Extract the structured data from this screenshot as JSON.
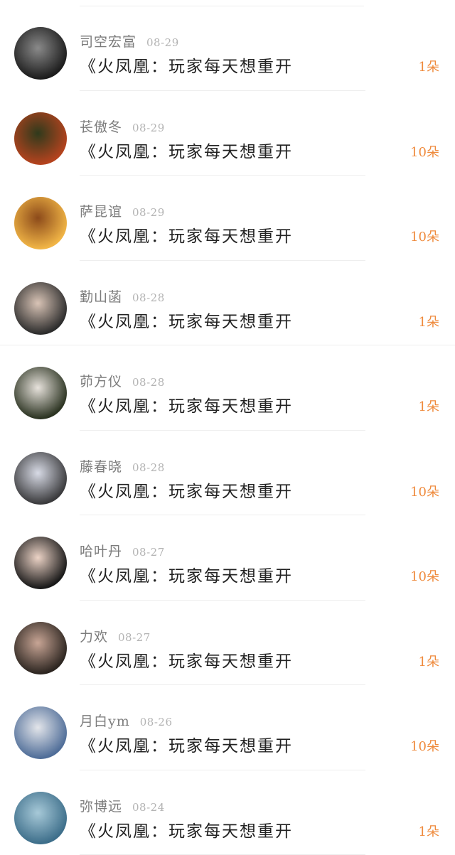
{
  "rows": [
    {
      "name": "司空宏富",
      "date": "08-29",
      "title": "《火凤凰：玩家每天想重开",
      "gift": "1朵",
      "avatar_icon": "avatar-user-1",
      "avatar_colors": [
        "#1c1c1c",
        "#8a8a8a"
      ]
    },
    {
      "name": "苌傲冬",
      "date": "08-29",
      "title": "《火凤凰：玩家每天想重开",
      "gift": "10朵",
      "avatar_icon": "avatar-user-2",
      "avatar_colors": [
        "#b5431e",
        "#2f3a1c"
      ]
    },
    {
      "name": "萨昆谊",
      "date": "08-29",
      "title": "《火凤凰：玩家每天想重开",
      "gift": "10朵",
      "avatar_icon": "avatar-user-3",
      "avatar_colors": [
        "#f1b546",
        "#8c4a1a"
      ]
    },
    {
      "name": "勤山菡",
      "date": "08-28",
      "title": "《火凤凰：玩家每天想重开",
      "gift": "1朵",
      "avatar_icon": "avatar-user-4",
      "avatar_colors": [
        "#2c2c2c",
        "#d9c4b6"
      ]
    },
    {
      "name": "茆方仪",
      "date": "08-28",
      "title": "《火凤凰：玩家每天想重开",
      "gift": "1朵",
      "avatar_icon": "avatar-user-5",
      "avatar_colors": [
        "#2b3321",
        "#e7e2dc"
      ]
    },
    {
      "name": "藤春晓",
      "date": "08-28",
      "title": "《火凤凰：玩家每天想重开",
      "gift": "10朵",
      "avatar_icon": "avatar-user-6",
      "avatar_colors": [
        "#3a3a3c",
        "#d8dbe6"
      ]
    },
    {
      "name": "哈叶丹",
      "date": "08-27",
      "title": "《火凤凰：玩家每天想重开",
      "gift": "10朵",
      "avatar_icon": "avatar-user-7",
      "avatar_colors": [
        "#181818",
        "#ecd3c6"
      ]
    },
    {
      "name": "力欢",
      "date": "08-27",
      "title": "《火凤凰：玩家每天想重开",
      "gift": "1朵",
      "avatar_icon": "avatar-user-8",
      "avatar_colors": [
        "#2c2520",
        "#c8a595"
      ]
    },
    {
      "name": "月白ym",
      "date": "08-26",
      "title": "《火凤凰：玩家每天想重开",
      "gift": "10朵",
      "avatar_icon": "avatar-user-9",
      "avatar_colors": [
        "#4f6d98",
        "#e3e5ea"
      ]
    },
    {
      "name": "弥博远",
      "date": "08-24",
      "title": "《火凤凰：玩家每天想重开",
      "gift": "1朵",
      "avatar_icon": "avatar-user-10",
      "avatar_colors": [
        "#3d6e8a",
        "#a7c9d8"
      ]
    }
  ]
}
